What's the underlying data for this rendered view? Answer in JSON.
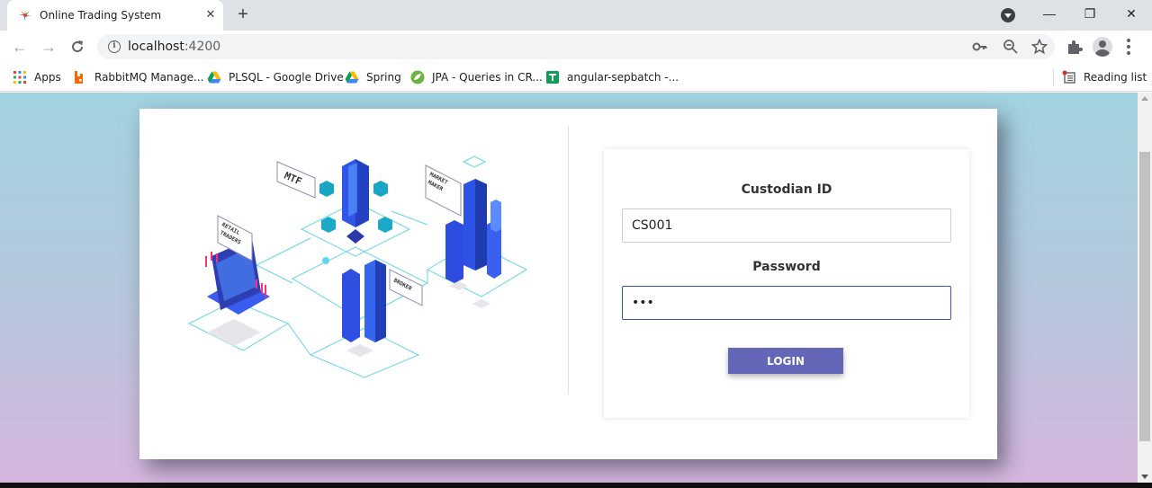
{
  "browser": {
    "tab_title": "Online Trading System",
    "tab_close": "✕",
    "new_tab": "+",
    "url_host": "localhost",
    "url_port": ":4200",
    "window_controls": {
      "minimize": "—",
      "restore": "❐",
      "close": "✕"
    }
  },
  "bookmarks": {
    "apps_label": "Apps",
    "items": [
      {
        "label": "RabbitMQ Manage...",
        "icon": "rabbitmq-icon"
      },
      {
        "label": "PLSQL - Google Drive",
        "icon": "google-drive-icon"
      },
      {
        "label": "Spring",
        "icon": "google-drive-icon"
      },
      {
        "label": "JPA - Queries in CR...",
        "icon": "spring-icon"
      },
      {
        "label": "angular-sepbatch -...",
        "icon": "google-sheets-icon"
      }
    ],
    "reading_list": "Reading list"
  },
  "illustration": {
    "mtf": "MTF",
    "market_maker_1": "MARKET",
    "market_maker_2": "MAKER",
    "retail_1": "RETAIL",
    "retail_2": "TRADERS",
    "broker": "BROKER"
  },
  "login": {
    "custodian_label": "Custodian ID",
    "custodian_value": "CS001",
    "password_label": "Password",
    "password_value": "•••",
    "login_button": "LOGIN"
  },
  "colors": {
    "accent": "#6467b8",
    "focus_border": "#3f51b5",
    "bg_top": "#a2d3e0",
    "bg_bottom": "#d6b6dd"
  }
}
